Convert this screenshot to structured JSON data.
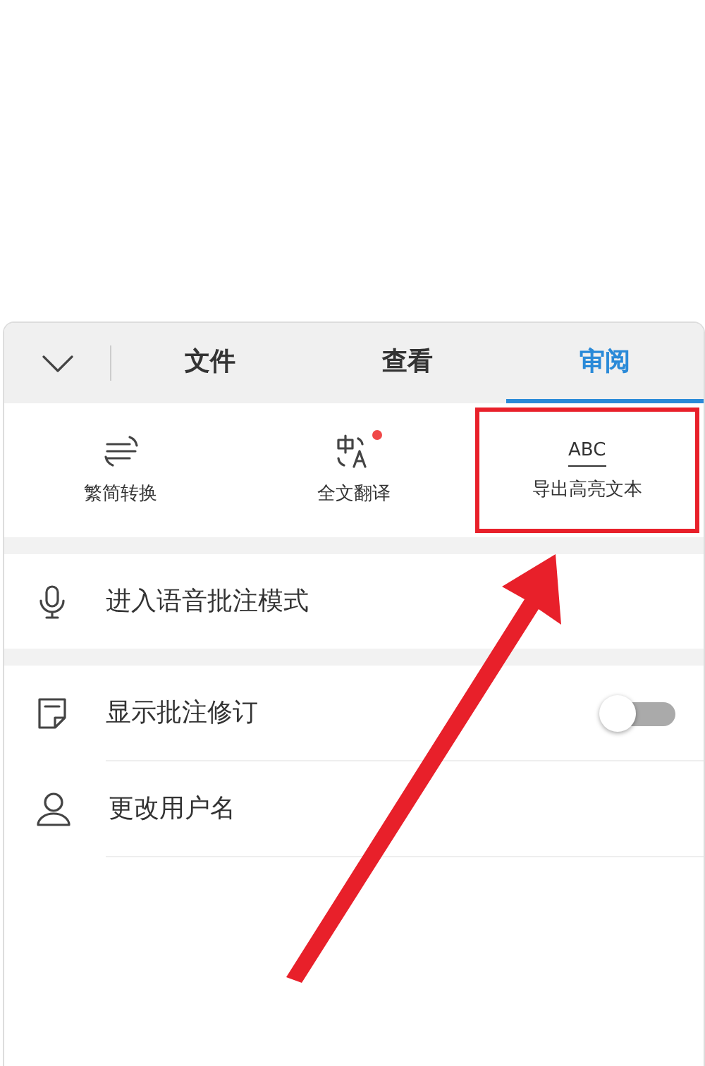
{
  "tabs": [
    {
      "label": "文件",
      "selected": false
    },
    {
      "label": "查看",
      "selected": false
    },
    {
      "label": "审阅",
      "selected": true
    }
  ],
  "tools": [
    {
      "kind": "convert",
      "label": "繁简转换",
      "badge": false,
      "highlighted": false
    },
    {
      "kind": "translate",
      "label": "全文翻译",
      "badge": true,
      "highlighted": false
    },
    {
      "kind": "abc",
      "icon_text": "ABC",
      "label": "导出高亮文本",
      "badge": false,
      "highlighted": true
    }
  ],
  "voice_item": {
    "label": "进入语音批注模式"
  },
  "settings": [
    {
      "kind": "toggle",
      "label": "显示批注修订",
      "on": false
    },
    {
      "kind": "user",
      "label": "更改用户名"
    }
  ]
}
